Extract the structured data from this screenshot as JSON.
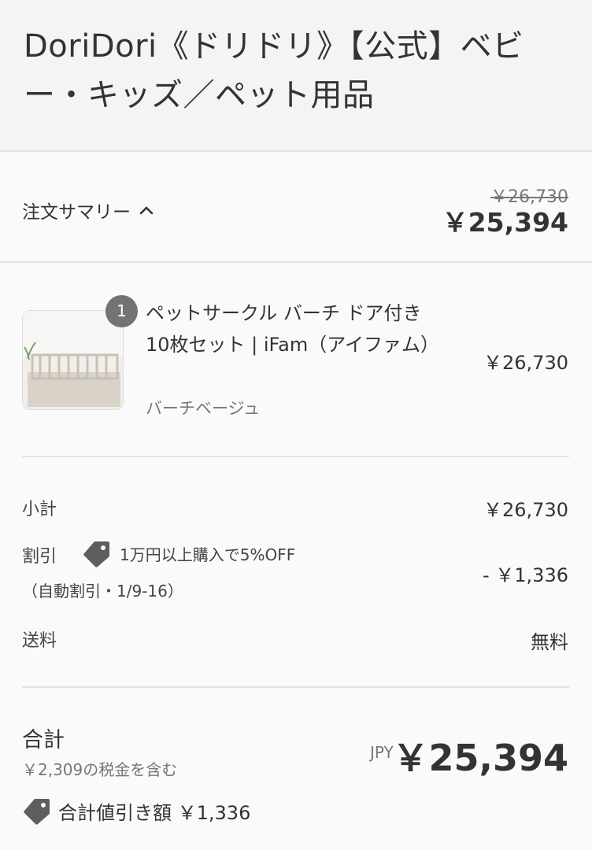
{
  "header": {
    "store_title": "DoriDori《ドリドリ》【公式】ベビー・キッズ／ペット用品"
  },
  "summary": {
    "toggle_label": "注文サマリー",
    "compare_price": "￥26,730",
    "total": "￥25,394"
  },
  "product": {
    "quantity": "1",
    "name": "ペットサークル バーチ ドア付き 10枚セット | iFam（アイファム）",
    "variant": "バーチベージュ",
    "price": "￥26,730"
  },
  "costs": {
    "subtotal_label": "小計",
    "subtotal_value": "￥26,730",
    "discount_label": "割引",
    "discount_name": "1万円以上購入で5%OFF",
    "discount_sub": "（自動割引・1/9-16）",
    "discount_value": "- ￥1,336",
    "shipping_label": "送料",
    "shipping_value": "無料"
  },
  "total": {
    "label": "合計",
    "tax_note": "￥2,309の税金を含む",
    "currency": "JPY",
    "value": "￥25,394",
    "savings": "合計値引き額 ￥1,336"
  },
  "icons": {
    "chevron": "chevron-up-icon",
    "tag": "tag-icon"
  },
  "colors": {
    "header_bg": "#f3f4f6",
    "badge_bg": "#737373",
    "tag": "#5e5e5e"
  }
}
